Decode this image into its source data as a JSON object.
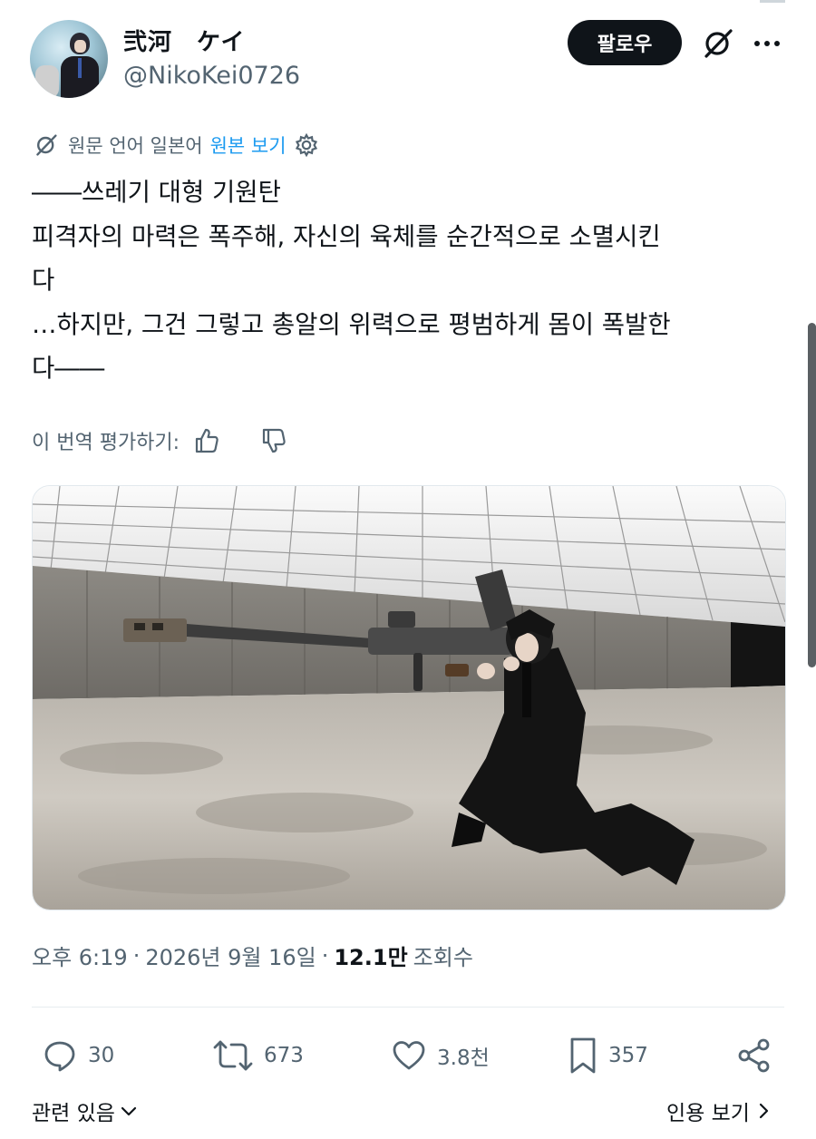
{
  "author": {
    "display_name": "弐河　ケイ",
    "handle": "@NikoKei0726"
  },
  "header": {
    "follow_label": "팔로우",
    "grok_icon": "grok-icon",
    "more_icon": "more-icon"
  },
  "translation": {
    "original_language_text": "원문 언어 일본어",
    "show_original_label": "원본 보기",
    "settings_icon": "gear-icon"
  },
  "post": {
    "text": "――쓰레기 대형 기원탄\n피격자의 마력은 폭주해, 자신의 육체를 순간적으로 소멸시킨\n다\n…하지만, 그건 그렇고 총알의 위력으로 평범하게 몸이 폭발한\n다――"
  },
  "rate_translation": {
    "label": "이 번역 평가하기:",
    "thumbs_up_icon": "thumbs-up-icon",
    "thumbs_down_icon": "thumbs-down-icon"
  },
  "meta": {
    "time": "오후 6:19",
    "separator": "·",
    "date": "2026년 9월 16일",
    "views_count": "12.1만",
    "views_label": "조회수"
  },
  "actions": {
    "replies": "30",
    "reposts": "673",
    "likes": "3.8천",
    "bookmarks": "357"
  },
  "footer": {
    "related_label": "관련 있음",
    "quotes_label": "인용 보기"
  },
  "colors": {
    "text": "#0f1419",
    "secondary": "#536471",
    "link": "#1d9bf0",
    "button_bg": "#0f1419"
  }
}
